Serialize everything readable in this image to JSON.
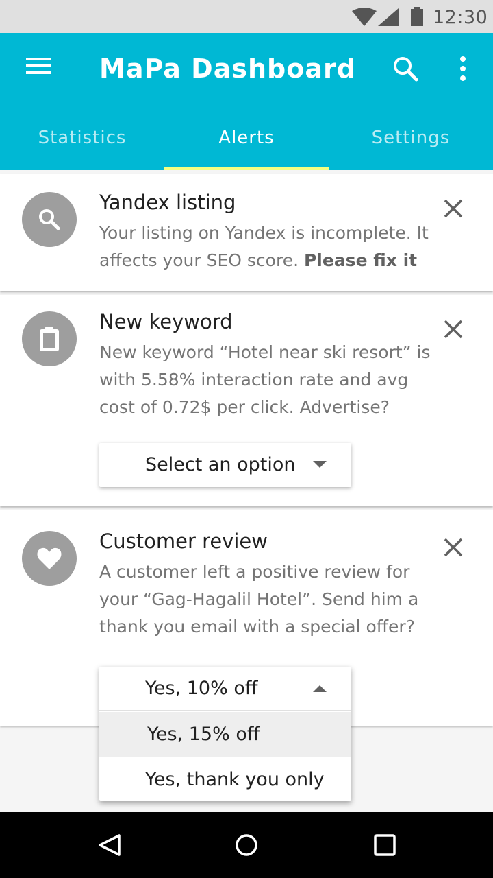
{
  "status_bar": {
    "time": "12:30",
    "icons": [
      "wifi-icon",
      "cell-signal-icon",
      "battery-icon"
    ]
  },
  "app_bar": {
    "title": "MaPa Dashboard",
    "icons": [
      "menu-icon",
      "search-icon",
      "more-vert-icon"
    ],
    "tabs": [
      {
        "label": "Statistics",
        "active": false
      },
      {
        "label": "Alerts",
        "active": true
      },
      {
        "label": "Settings",
        "active": false
      }
    ],
    "colors": {
      "primary": "#00b8d4",
      "indicator": "#f4ff81"
    }
  },
  "alerts": [
    {
      "icon": "search-icon",
      "title": "Yandex listing",
      "body_line1": "Your listing on Yandex is incomplete. It",
      "body_line2": "affects your SEO score.",
      "body_strong": "Please fix it"
    },
    {
      "icon": "clipboard-icon",
      "title": "New keyword",
      "body_line1": "New keyword “Hotel near ski resort” is",
      "body_line2": "with 5.58% interaction rate and avg",
      "body_line3": "cost of 0.72$ per click. Advertise?",
      "dropdown": {
        "value": "Select an option",
        "state": "collapsed"
      }
    },
    {
      "icon": "heart-icon",
      "title": "Customer review",
      "body_line1": "A customer left a positive review for",
      "body_line2": "your “Gag-Hagalil Hotel”. Send him a",
      "body_line3": "thank you email with a special offer?",
      "dropdown": {
        "value": "Yes, 10% off",
        "state": "expanded",
        "options": [
          "Yes, 15% off",
          "Yes, thank you only"
        ]
      }
    }
  ],
  "nav_bar": {
    "icons": [
      "back-icon",
      "home-icon",
      "recents-icon"
    ]
  }
}
